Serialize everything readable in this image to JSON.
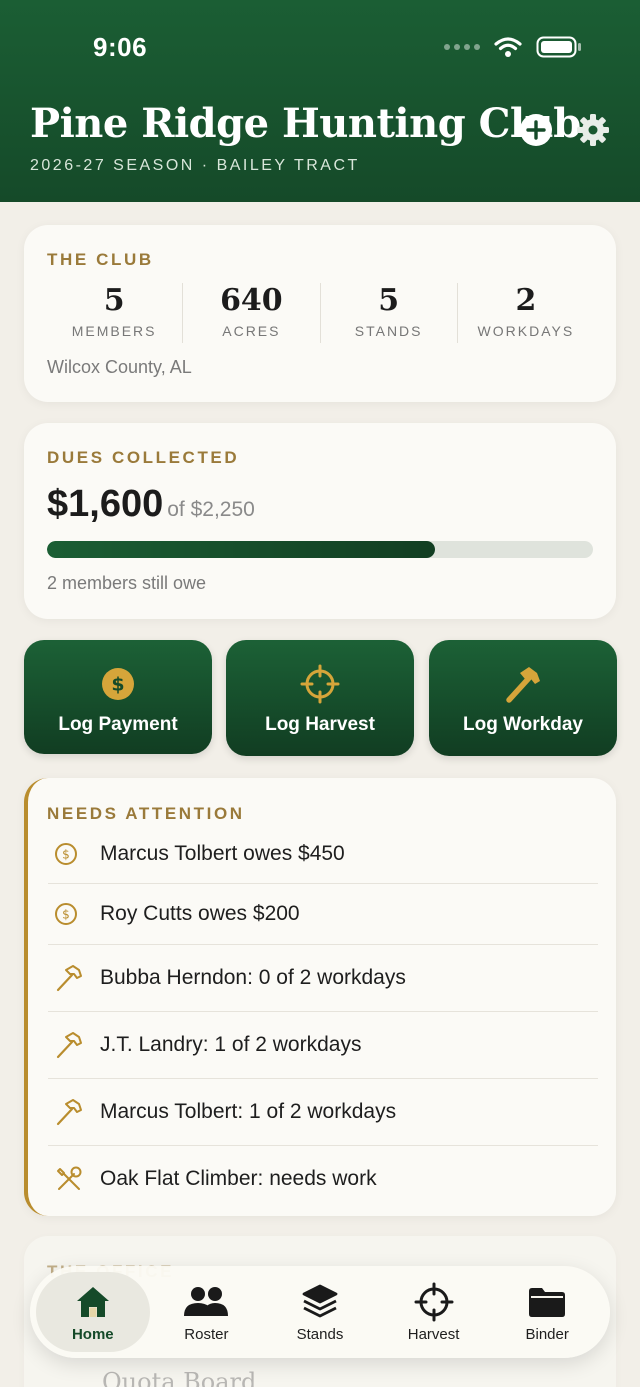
{
  "status": {
    "time": "9:06"
  },
  "header": {
    "title": "Pine Ridge Hunting Club",
    "subtitle": "2026-27 SEASON · BAILEY TRACT"
  },
  "club": {
    "label": "THE CLUB",
    "stats": [
      {
        "value": "5",
        "label": "MEMBERS"
      },
      {
        "value": "640",
        "label": "ACRES"
      },
      {
        "value": "5",
        "label": "STANDS"
      },
      {
        "value": "2",
        "label": "WORKDAYS"
      }
    ],
    "location": "Wilcox County, AL"
  },
  "dues": {
    "label": "DUES COLLECTED",
    "collected": "$1,600",
    "of_total": "of $2,250",
    "progress_fraction": 0.711,
    "note": "2 members still owe"
  },
  "actions": [
    {
      "label": "Log Payment",
      "icon": "dollar-coin-icon"
    },
    {
      "label": "Log Harvest",
      "icon": "crosshair-icon"
    },
    {
      "label": "Log Workday",
      "icon": "hammer-icon"
    }
  ],
  "attention": {
    "label": "NEEDS ATTENTION",
    "items": [
      {
        "icon": "dollar-circle-icon",
        "text": "Marcus Tolbert owes $450"
      },
      {
        "icon": "dollar-circle-icon",
        "text": "Roy Cutts owes $200"
      },
      {
        "icon": "hammer-icon",
        "text": "Bubba Herndon: 0 of 2 workdays"
      },
      {
        "icon": "hammer-icon",
        "text": "J.T. Landry: 1 of 2 workdays"
      },
      {
        "icon": "hammer-icon",
        "text": "Marcus Tolbert: 1 of 2 workdays"
      },
      {
        "icon": "wrench-screwdriver-icon",
        "text": "Oak Flat Climber: needs work"
      }
    ]
  },
  "office": {
    "label": "THE OFFICE",
    "line": "Quota Board"
  },
  "tabs": [
    {
      "label": "Home",
      "icon": "house-icon",
      "active": true
    },
    {
      "label": "Roster",
      "icon": "people-icon"
    },
    {
      "label": "Stands",
      "icon": "layers-icon"
    },
    {
      "label": "Harvest",
      "icon": "crosshair-icon"
    },
    {
      "label": "Binder",
      "icon": "folder-icon"
    }
  ],
  "colors": {
    "brand_green": "#1b5e34",
    "accent_gold": "#b98d2e"
  }
}
